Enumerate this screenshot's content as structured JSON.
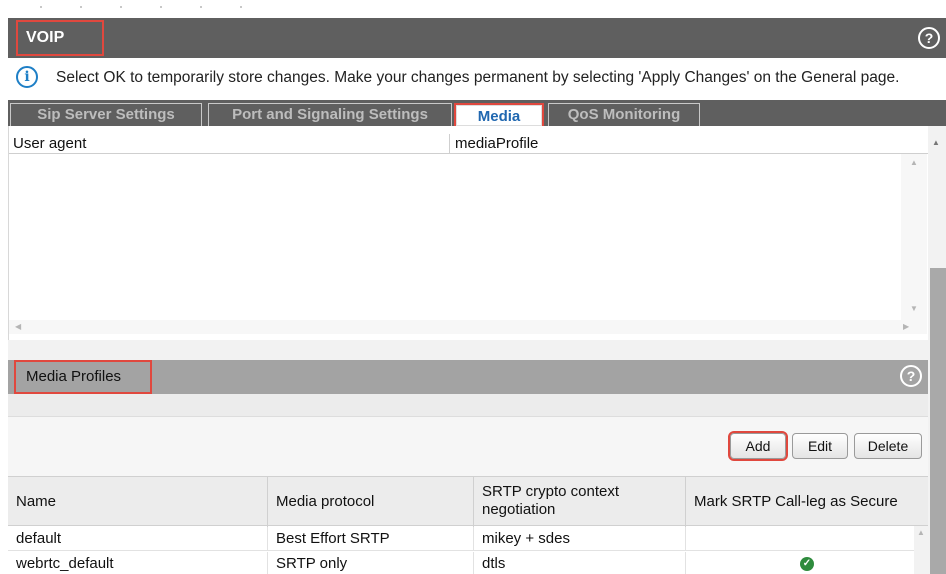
{
  "header": {
    "title": "VOIP"
  },
  "info": {
    "message": "Select OK to temporarily store changes. Make your changes permanent by selecting 'Apply Changes' on the General page."
  },
  "tabs": [
    {
      "label": "Sip Server Settings"
    },
    {
      "label": "Port and Signaling Settings"
    },
    {
      "label": "Media"
    },
    {
      "label": "QoS Monitoring"
    }
  ],
  "user_agent_table": {
    "columns": [
      "User agent",
      "mediaProfile"
    ]
  },
  "media_profiles": {
    "title": "Media Profiles",
    "buttons": {
      "add": "Add",
      "edit": "Edit",
      "delete": "Delete"
    },
    "columns": [
      "Name",
      "Media protocol",
      "SRTP crypto context negotiation",
      "Mark SRTP Call-leg as Secure"
    ],
    "rows": [
      {
        "name": "default",
        "protocol": "Best Effort SRTP",
        "negotiation": "mikey + sdes",
        "secure": false
      },
      {
        "name": "webrtc_default",
        "protocol": "SRTP only",
        "negotiation": "dtls",
        "secure": true
      }
    ]
  },
  "colors": {
    "header_bg": "#5f5f5f",
    "section_bg": "#a3a3a3",
    "active_tab_text": "#2067b0",
    "highlight": "#e0483e",
    "info_icon": "#1e7fc6",
    "check": "#2e8b3d"
  },
  "icons": {
    "help": "help-icon",
    "info": "info-icon",
    "secure": "check-circle-icon"
  }
}
